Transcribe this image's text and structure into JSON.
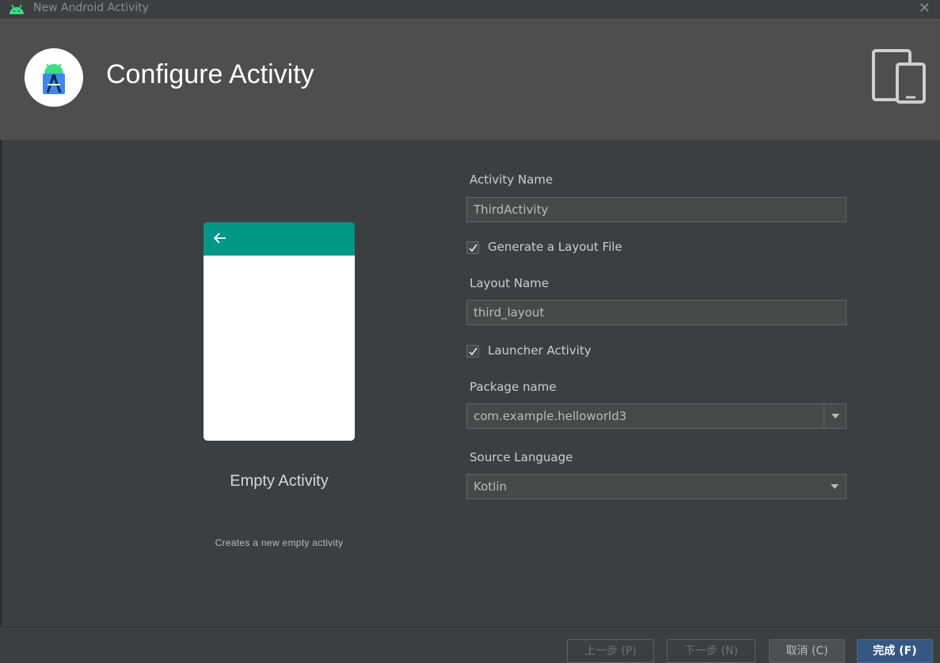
{
  "window": {
    "title": "New Android Activity",
    "close_icon": "close-icon",
    "app_icon": "android-icon"
  },
  "header": {
    "title": "Configure Activity",
    "logo_icon": "android-studio-logo-icon",
    "devices_icon": "devices-icon"
  },
  "template": {
    "name": "Empty Activity",
    "description": "Creates a new empty activity",
    "appbar_color": "#009688"
  },
  "form": {
    "activity_name_label": "Activity Name",
    "activity_name_value": "ThirdActivity",
    "generate_layout_label": "Generate a Layout File",
    "generate_layout_checked": true,
    "layout_name_label": "Layout Name",
    "layout_name_value": "third_layout",
    "launcher_activity_label": "Launcher Activity",
    "launcher_activity_checked": true,
    "package_name_label": "Package name",
    "package_name_value": "com.example.helloworld3",
    "source_language_label": "Source Language",
    "source_language_value": "Kotlin"
  },
  "footer": {
    "previous_label": "上一步 (P)",
    "next_label": "下一步 (N)",
    "cancel_label": "取消 (C)",
    "finish_label": "完成 (F)"
  }
}
